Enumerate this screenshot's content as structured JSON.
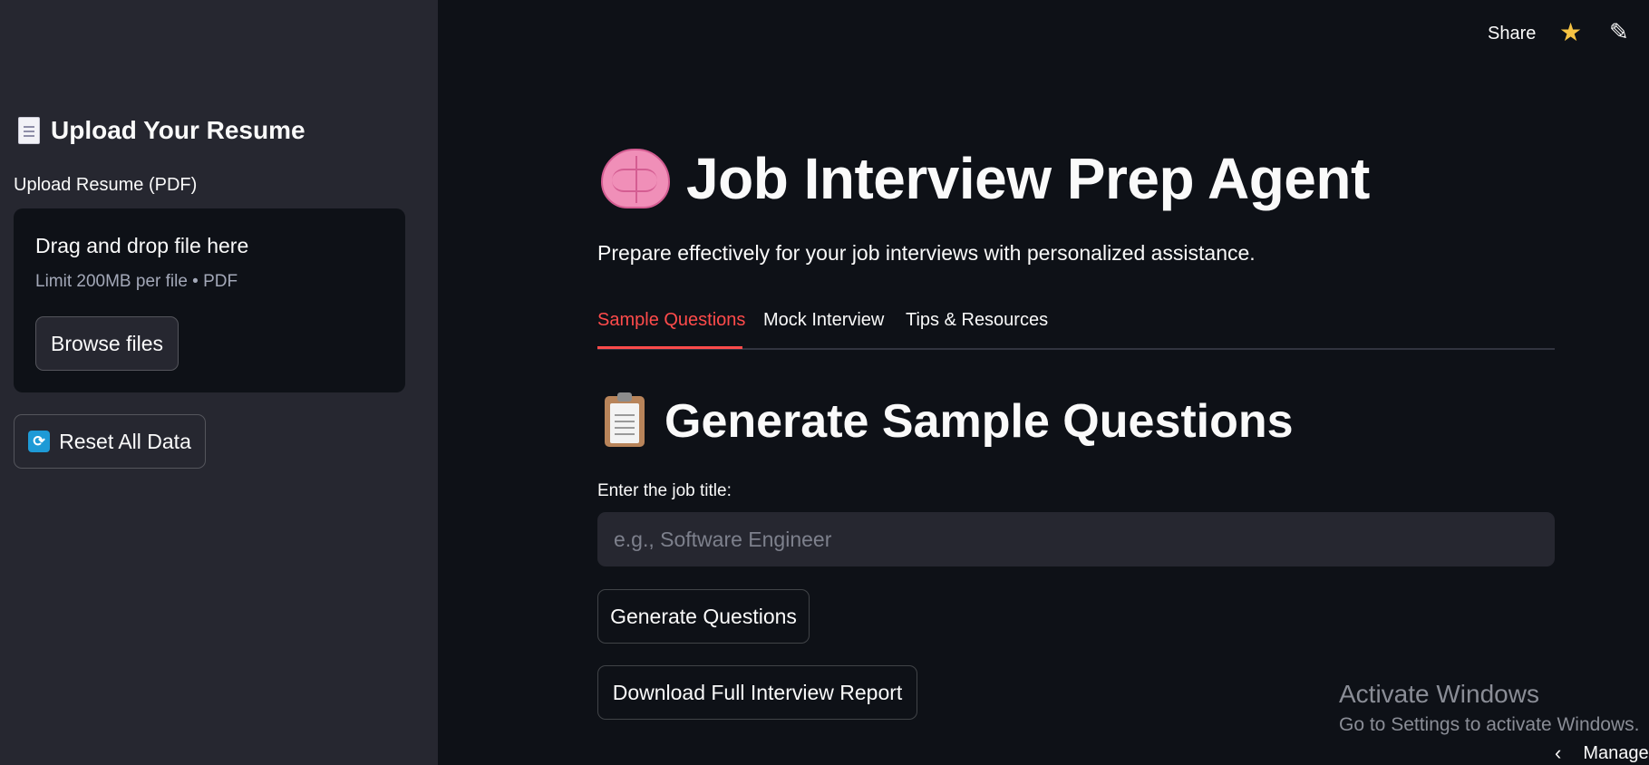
{
  "header": {
    "share_label": "Share",
    "star_icon": "star-icon",
    "edit_icon": "pencil-icon"
  },
  "sidebar": {
    "title": "Upload Your Resume",
    "title_icon": "document-icon",
    "upload_label": "Upload Resume (PDF)",
    "dropzone": {
      "title": "Drag and drop file here",
      "limit": "Limit 200MB per file • PDF",
      "browse_label": "Browse files"
    },
    "reset_label": "Reset All Data",
    "reset_icon": "refresh-icon"
  },
  "main": {
    "title": "Job Interview Prep Agent",
    "title_icon": "brain-icon",
    "subtitle": "Prepare effectively for your job interviews with personalized assistance.",
    "tabs": [
      {
        "label": "Sample Questions",
        "active": true
      },
      {
        "label": "Mock Interview",
        "active": false
      },
      {
        "label": "Tips & Resources",
        "active": false
      }
    ],
    "section_title": "Generate Sample Questions",
    "section_icon": "clipboard-icon",
    "job_title_label": "Enter the job title:",
    "job_title_value": "",
    "job_title_placeholder": "e.g., Software Engineer",
    "generate_label": "Generate Questions",
    "download_label": "Download Full Interview Report"
  },
  "watermark": {
    "title": "Activate Windows",
    "subtitle": "Go to Settings to activate Windows."
  },
  "taskbar": {
    "manage_label": "Manage"
  },
  "colors": {
    "background": "#0e1117",
    "sidebar": "#262730",
    "accent": "#ff4b4b"
  }
}
